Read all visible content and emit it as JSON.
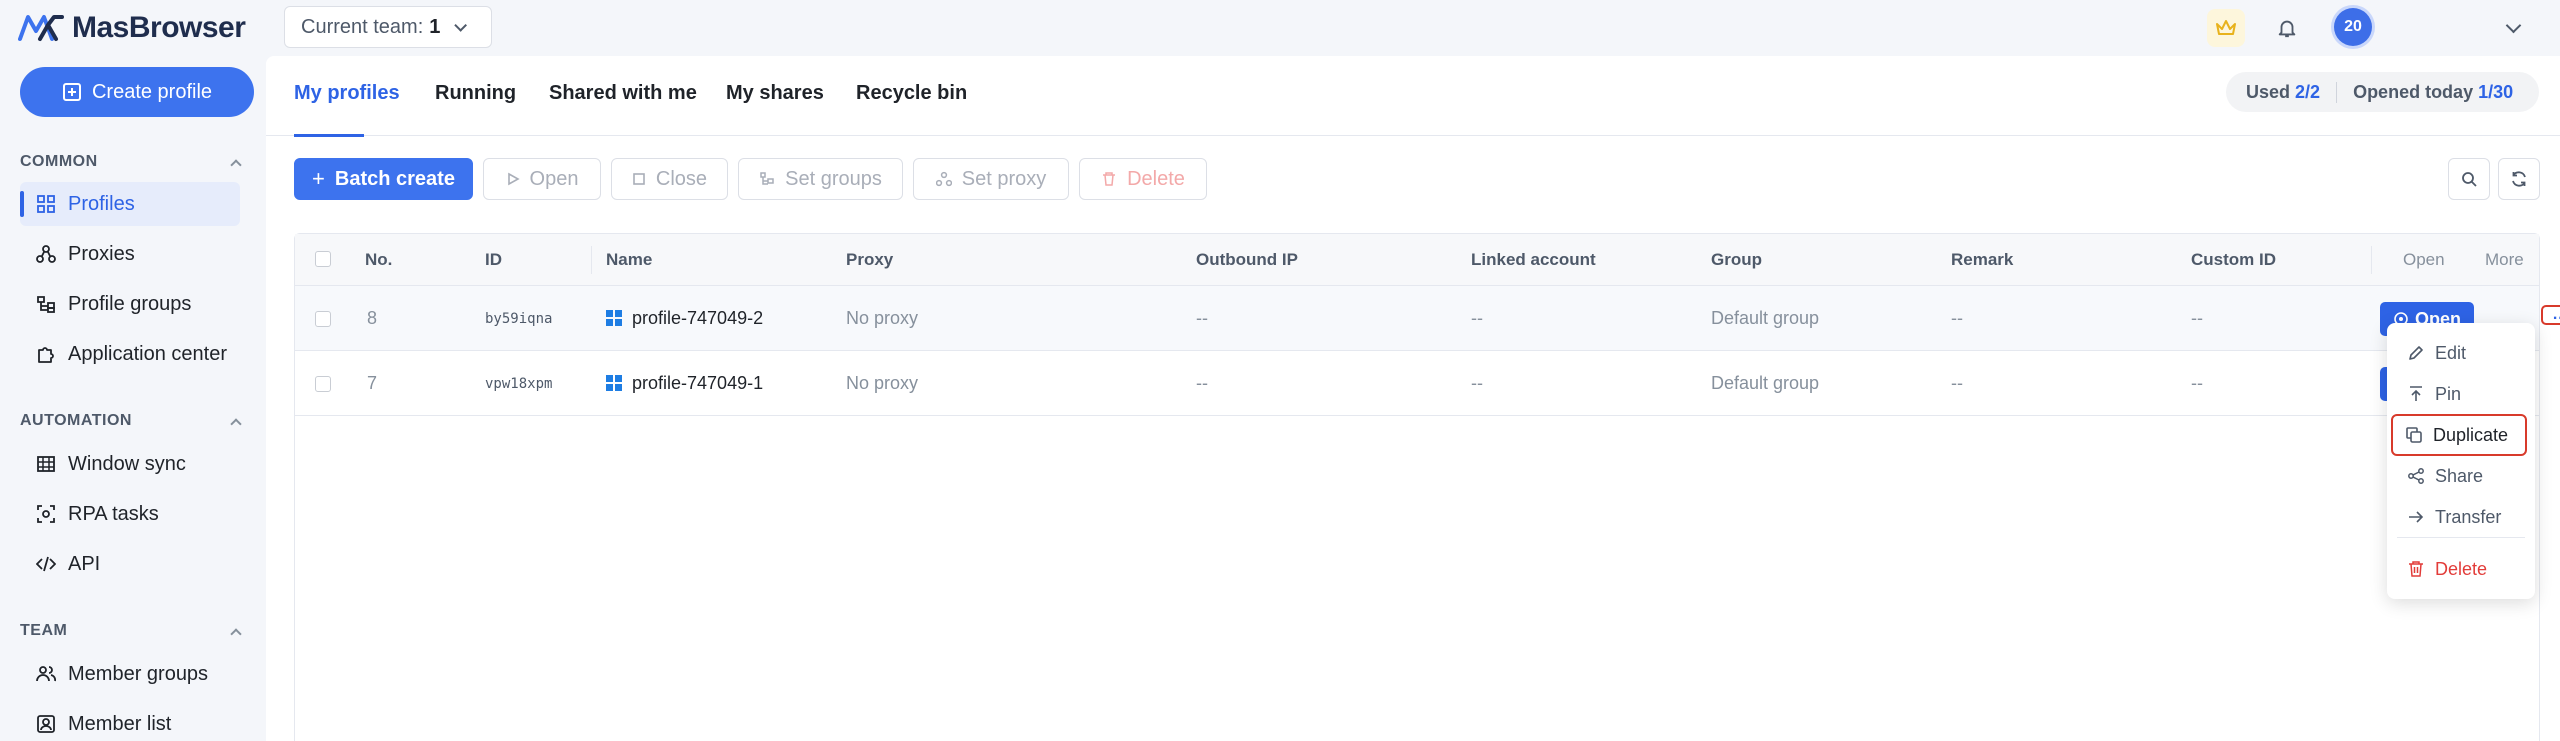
{
  "brand": {
    "name": "MasBrowser",
    "accent": "#3d73ee"
  },
  "team": {
    "label": "Current team:",
    "value": "1"
  },
  "user": {
    "avatar_text": "20"
  },
  "sidebar": {
    "create_label": "Create profile",
    "sections": [
      {
        "title": "COMMON",
        "items": [
          "Profiles",
          "Proxies",
          "Profile groups",
          "Application center"
        ]
      },
      {
        "title": "AUTOMATION",
        "items": [
          "Window sync",
          "RPA tasks",
          "API"
        ]
      },
      {
        "title": "TEAM",
        "items": [
          "Member groups",
          "Member list"
        ]
      }
    ]
  },
  "tabs": [
    "My profiles",
    "Running",
    "Shared with me",
    "My shares",
    "Recycle bin"
  ],
  "usage": {
    "used_label": "Used",
    "used_value": "2/2",
    "opened_label": "Opened today",
    "opened_value": "1/30"
  },
  "toolbar": {
    "batch_create": "Batch create",
    "open": "Open",
    "close": "Close",
    "set_groups": "Set groups",
    "set_proxy": "Set proxy",
    "delete": "Delete"
  },
  "table": {
    "headers": [
      "No.",
      "ID",
      "Name",
      "Proxy",
      "Outbound IP",
      "Linked account",
      "Group",
      "Remark",
      "Custom ID",
      "Open",
      "More"
    ],
    "rows": [
      {
        "no": "8",
        "id": "by59iqna",
        "name": "profile-747049-2",
        "proxy": "No proxy",
        "outbound_ip": "--",
        "linked": "--",
        "group": "Default group",
        "remark": "--",
        "custom_id": "--",
        "open": "Open",
        "more": "..."
      },
      {
        "no": "7",
        "id": "vpw18xpm",
        "name": "profile-747049-1",
        "proxy": "No proxy",
        "outbound_ip": "--",
        "linked": "--",
        "group": "Default group",
        "remark": "--",
        "custom_id": "--"
      }
    ]
  },
  "menu": {
    "items": [
      "Edit",
      "Pin",
      "Duplicate",
      "Share",
      "Transfer",
      "Delete"
    ]
  }
}
